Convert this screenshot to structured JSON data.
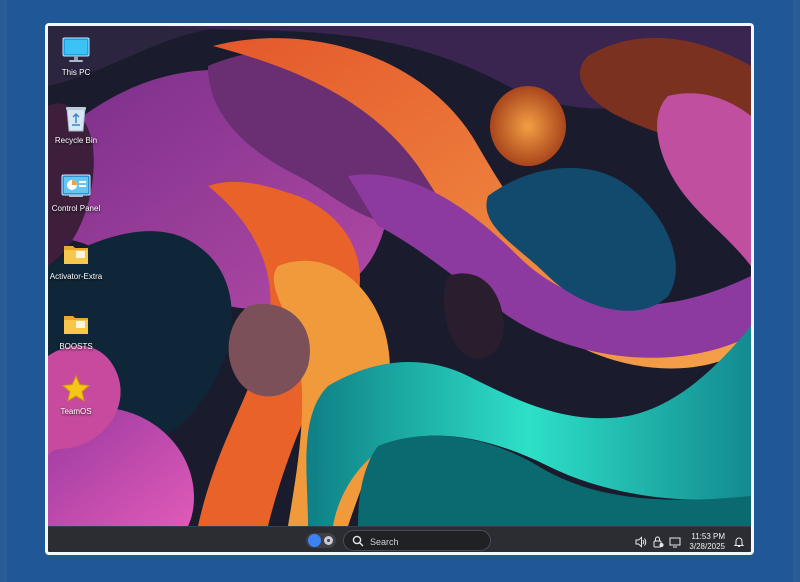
{
  "desktop_icons": [
    {
      "label": "This PC",
      "icon": "monitor-icon"
    },
    {
      "label": "Recycle Bin",
      "icon": "recycle-bin-icon"
    },
    {
      "label": "Control Panel",
      "icon": "control-panel-icon"
    },
    {
      "label": "Activator-Extra",
      "icon": "folder-icon"
    },
    {
      "label": "BOOSTS",
      "icon": "folder-icon"
    },
    {
      "label": "TeamOS",
      "icon": "star-icon"
    }
  ],
  "taskbar": {
    "search_placeholder": "Search",
    "clock_time": "11:53 PM",
    "clock_date": "3/28/2025",
    "tray_icons": [
      "speaker-icon",
      "security-icon",
      "display-icon",
      "notification-bell-icon"
    ]
  },
  "colors": {
    "frame_blue": "#2a5c98",
    "taskbar": "#2b2d33",
    "start_accent": "#3b82f6",
    "folder_yellow": "#f6c74a",
    "star_gold": "#f5c518"
  }
}
